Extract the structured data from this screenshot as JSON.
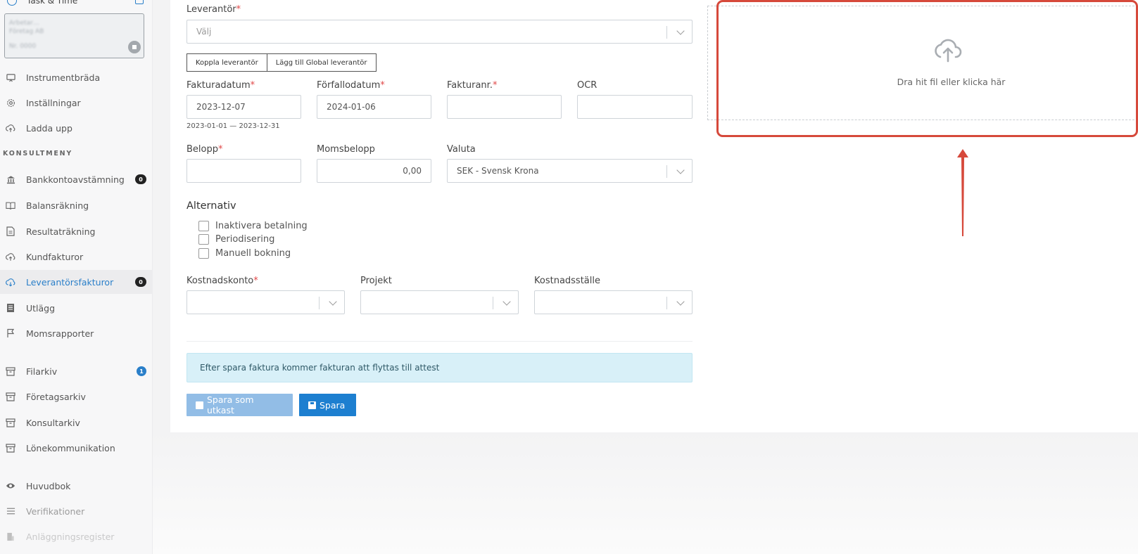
{
  "sidebar": {
    "top_item": {
      "label": "Task & Time",
      "icon": "clock-icon"
    },
    "company": {
      "line1": "Arbetar…",
      "line2": "Företag AB",
      "line3": "Nr. 0000"
    },
    "section_heading": "KONSULTMENY",
    "items": [
      {
        "label": "Instrumentbräda",
        "icon": "monitor-icon"
      },
      {
        "label": "Inställningar",
        "icon": "gear-icon"
      },
      {
        "label": "Ladda upp",
        "icon": "cloud-upload-icon"
      },
      {
        "label": "Bankkontoavstämning",
        "icon": "bank-icon",
        "badge": "0"
      },
      {
        "label": "Balansräkning",
        "icon": "book-icon"
      },
      {
        "label": "Resultaträkning",
        "icon": "document-icon"
      },
      {
        "label": "Kundfakturor",
        "icon": "cloud-upload-icon"
      },
      {
        "label": "Leverantörsfakturor",
        "icon": "cloud-download-icon",
        "badge": "0",
        "active": true
      },
      {
        "label": "Utlägg",
        "icon": "receipt-icon"
      },
      {
        "label": "Momsrapporter",
        "icon": "flag-icon"
      },
      {
        "label": "Filarkiv",
        "icon": "archive-icon",
        "badge": "1"
      },
      {
        "label": "Företagsarkiv",
        "icon": "archive-icon"
      },
      {
        "label": "Konsultarkiv",
        "icon": "archive-icon"
      },
      {
        "label": "Lönekommunikation",
        "icon": "archive-icon"
      },
      {
        "label": "Huvudbok",
        "icon": "eye-icon"
      },
      {
        "label": "Verifikationer",
        "icon": "list-icon"
      },
      {
        "label": "Anläggningsregister",
        "icon": "building-icon"
      }
    ]
  },
  "form": {
    "supplier": {
      "label": "Leverantör",
      "required": "*",
      "placeholder": "Välj"
    },
    "supplier_buttons": {
      "link": "Koppla leverantör",
      "add_global": "Lägg till Global leverantör"
    },
    "invoice_date": {
      "label": "Fakturadatum",
      "required": "*",
      "value": "2023-12-07"
    },
    "due_date": {
      "label": "Förfallodatum",
      "required": "*",
      "value": "2024-01-06"
    },
    "invoice_no": {
      "label": "Fakturanr.",
      "required": "*",
      "value": ""
    },
    "ocr": {
      "label": "OCR",
      "value": ""
    },
    "period_hint": "2023-01-01 — 2023-12-31",
    "amount": {
      "label": "Belopp",
      "required": "*",
      "value": ""
    },
    "vat_amount": {
      "label": "Momsbelopp",
      "value": "0,00"
    },
    "currency": {
      "label": "Valuta",
      "value": "SEK - Svensk Krona"
    },
    "alternatives": {
      "title": "Alternativ",
      "options": [
        "Inaktivera betalning",
        "Periodisering",
        "Manuell bokning"
      ]
    },
    "cost_account": {
      "label": "Kostnadskonto",
      "required": "*"
    },
    "project": {
      "label": "Projekt"
    },
    "cost_center": {
      "label": "Kostnadsställe"
    },
    "info_message": "Efter spara faktura kommer fakturan att flyttas till attest",
    "save_draft_label": "Spara som utkast",
    "save_label": "Spara"
  },
  "upload": {
    "text": "Dra hit fil eller klicka här",
    "icon": "cloud-upload-icon"
  },
  "annotation": {
    "highlight_color": "#d6493b"
  },
  "colors": {
    "accent": "#1d7fd0",
    "required": "#e04848",
    "info_bg": "#d8f0f8"
  }
}
